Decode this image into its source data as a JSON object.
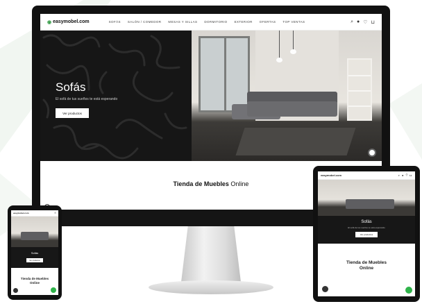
{
  "desktop": {
    "logo": "easymobel.com",
    "nav": [
      "Sofás",
      "Salón / Comedor",
      "Mesas y Sillas",
      "Dormitorio",
      "Exterior",
      "Ofertas",
      "Top Ventas"
    ],
    "icons": [
      "search-icon",
      "user-icon",
      "heart-icon",
      "cart-icon"
    ],
    "hero_title": "Sofás",
    "hero_subtitle": "El sofá de tus sueños te está esperando",
    "hero_button": "Ver productos",
    "tagline_bold": "Tienda de Muebles",
    "tagline_light": "Online"
  },
  "tablet": {
    "logo": "easymobel.com",
    "hero_title": "Sofás",
    "hero_subtitle": "El sofá de tus sueños te está esperando",
    "hero_button": "Ver productos",
    "tagline_line1": "Tienda de Muebles",
    "tagline_line2": "Online"
  },
  "phone": {
    "logo": "easymobel.com",
    "hero_title": "Sofás",
    "hero_button": "Ver productos",
    "tagline_line1": "Tienda de Muebles",
    "tagline_line2": "Online"
  },
  "colors": {
    "accent_green": "#3a9d4b",
    "whatsapp_green": "#2fb34a",
    "hero_dark": "#161616",
    "device_frame": "#111111",
    "background_deco": "#f1f6f1"
  }
}
